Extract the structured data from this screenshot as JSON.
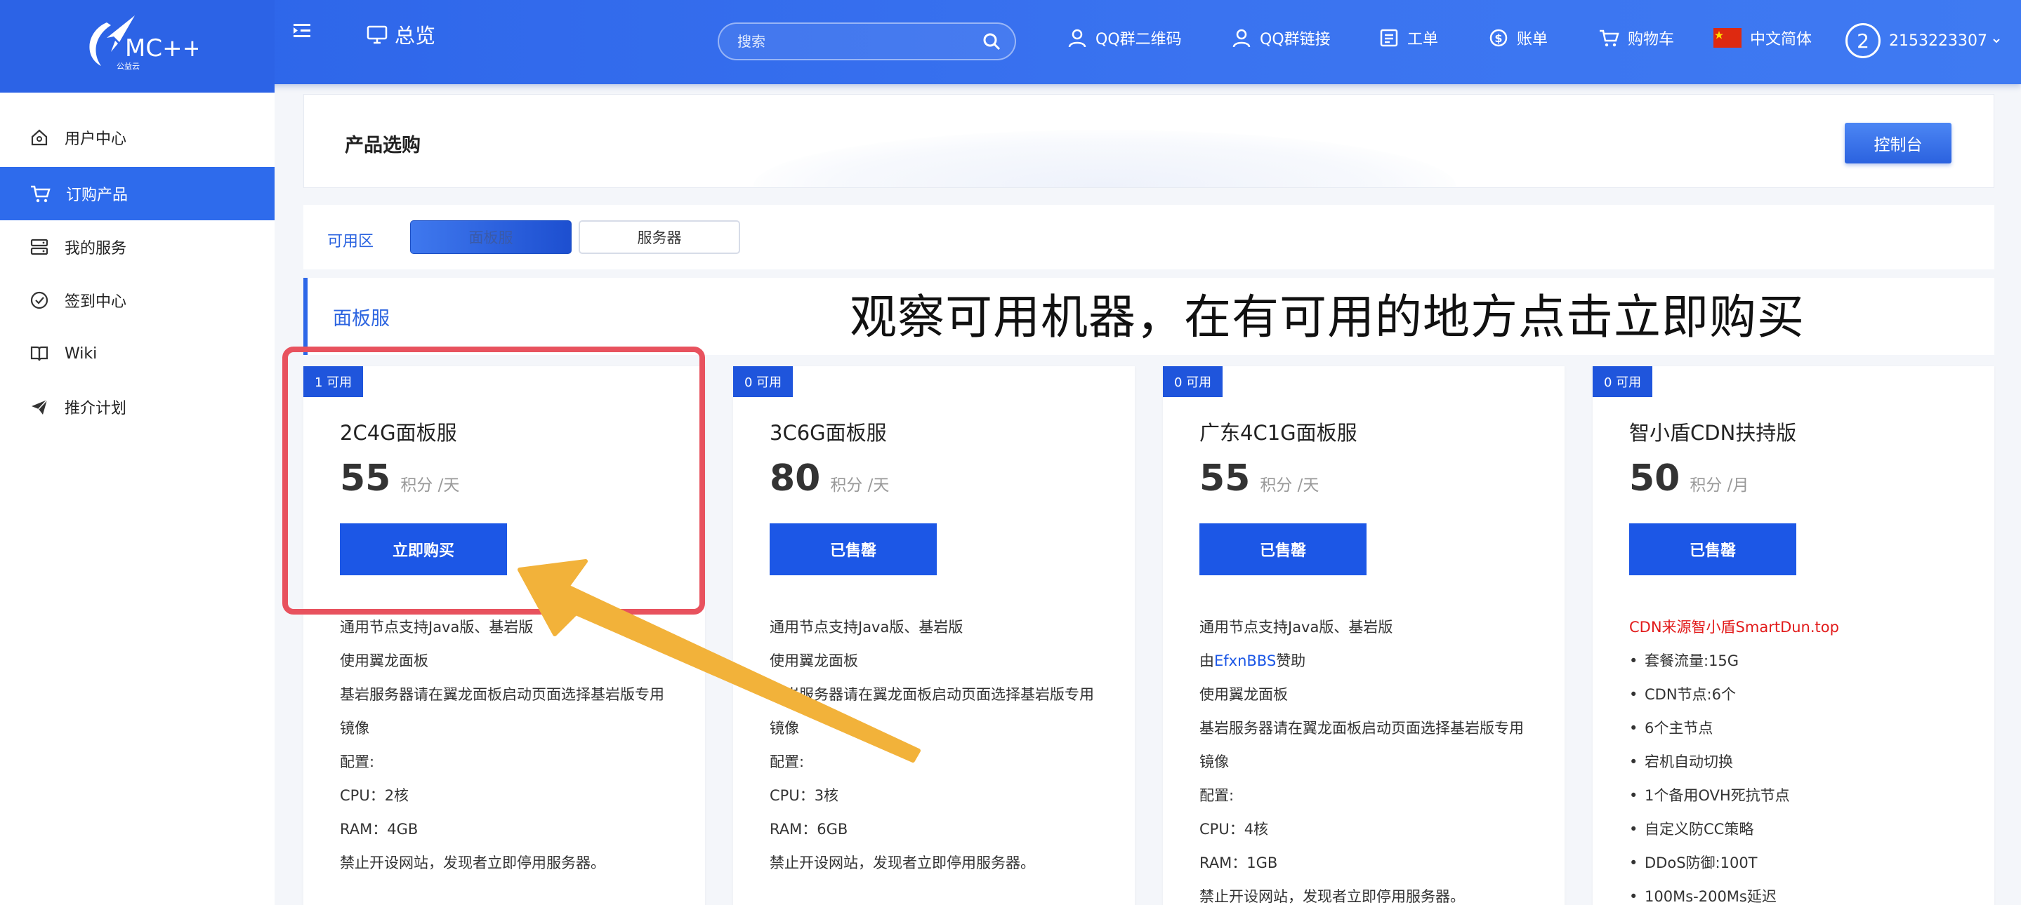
{
  "header": {
    "brand": "MC++",
    "brand_sub": "公益云",
    "overview": "总览",
    "search_placeholder": "搜索",
    "nav": {
      "qq_qrcode": "QQ群二维码",
      "qq_link": "QQ群链接",
      "ticket": "工单",
      "bill": "账单",
      "cart": "购物车",
      "language": "中文简体",
      "avatar_initial": "2",
      "username": "2153223307"
    }
  },
  "sidebar": {
    "items": [
      {
        "label": "用户中心",
        "icon": "home-icon"
      },
      {
        "label": "订购产品",
        "icon": "cart-icon",
        "active": true
      },
      {
        "label": "我的服务",
        "icon": "server-icon"
      },
      {
        "label": "签到中心",
        "icon": "check-circle-icon"
      },
      {
        "label": "Wiki",
        "icon": "book-icon"
      },
      {
        "label": "推介计划",
        "icon": "send-icon"
      }
    ]
  },
  "main": {
    "page_title": "产品选购",
    "console_button": "控制台",
    "zone_label": "可用区",
    "zone_tabs": [
      "面板服",
      "服务器"
    ],
    "section_title": "面板服",
    "annotation": "观察可用机器，在有可用的地方点击立即购买",
    "cards": [
      {
        "badge": "1 可用",
        "title": "2C4G面板服",
        "price": "55",
        "unit": "积分 /天",
        "button": "立即购买",
        "features": [
          "通用节点支持Java版、基岩版",
          "使用翼龙面板",
          "基岩服务器请在翼龙面板启动页面选择基岩版专用镜像",
          "配置:",
          "CPU：2核",
          "RAM：4GB",
          "禁止开设网站，发现者立即停用服务器。"
        ]
      },
      {
        "badge": "0 可用",
        "title": "3C6G面板服",
        "price": "80",
        "unit": "积分 /天",
        "button": "已售罄",
        "features": [
          "通用节点支持Java版、基岩版",
          "使用翼龙面板",
          "基岩服务器请在翼龙面板启动页面选择基岩版专用镜像",
          "配置:",
          "CPU：3核",
          "RAM：6GB",
          "禁止开设网站，发现者立即停用服务器。"
        ]
      },
      {
        "badge": "0 可用",
        "title": "广东4C1G面板服",
        "price": "55",
        "unit": "积分 /天",
        "button": "已售罄",
        "sponsor_prefix": "由",
        "sponsor_name": "EfxnBBS",
        "sponsor_suffix": "赞助",
        "features_before": [
          "通用节点支持Java版、基岩版"
        ],
        "features": [
          "使用翼龙面板",
          "基岩服务器请在翼龙面板启动页面选择基岩版专用镜像",
          "配置:",
          "CPU：4核",
          "RAM：1GB",
          "禁止开设网站，发现者立即停用服务器。"
        ]
      },
      {
        "badge": "0 可用",
        "title": "智小盾CDN扶持版",
        "price": "50",
        "unit": "积分 /月",
        "button": "已售罄",
        "source": "CDN来源智小盾SmartDun.top",
        "features": [
          "套餐流量:15G",
          "CDN节点:6个",
          "6个主节点",
          "宕机自动切换",
          "1个备用OVH死抗节点",
          "自定义防CC策略",
          "DDoS防御:100T",
          "100Ms-200Ms延迟"
        ]
      }
    ]
  },
  "colors": {
    "primary": "#2b63e8",
    "highlight": "#e8525e",
    "arrow": "#f2b23a",
    "sold_out": "#1c57e6",
    "cdn_source": "#e21b1b"
  }
}
